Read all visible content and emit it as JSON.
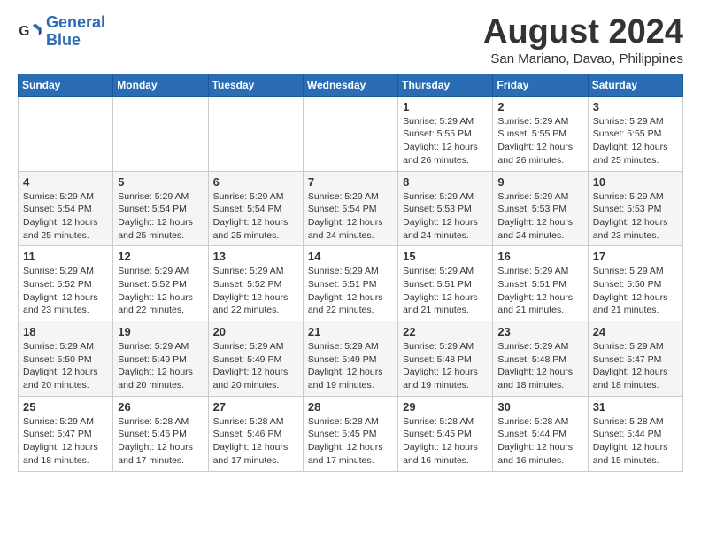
{
  "logo": {
    "line1": "General",
    "line2": "Blue"
  },
  "title": "August 2024",
  "location": "San Mariano, Davao, Philippines",
  "weekdays": [
    "Sunday",
    "Monday",
    "Tuesday",
    "Wednesday",
    "Thursday",
    "Friday",
    "Saturday"
  ],
  "weeks": [
    [
      {
        "day": "",
        "detail": ""
      },
      {
        "day": "",
        "detail": ""
      },
      {
        "day": "",
        "detail": ""
      },
      {
        "day": "",
        "detail": ""
      },
      {
        "day": "1",
        "detail": "Sunrise: 5:29 AM\nSunset: 5:55 PM\nDaylight: 12 hours\nand 26 minutes."
      },
      {
        "day": "2",
        "detail": "Sunrise: 5:29 AM\nSunset: 5:55 PM\nDaylight: 12 hours\nand 26 minutes."
      },
      {
        "day": "3",
        "detail": "Sunrise: 5:29 AM\nSunset: 5:55 PM\nDaylight: 12 hours\nand 25 minutes."
      }
    ],
    [
      {
        "day": "4",
        "detail": "Sunrise: 5:29 AM\nSunset: 5:54 PM\nDaylight: 12 hours\nand 25 minutes."
      },
      {
        "day": "5",
        "detail": "Sunrise: 5:29 AM\nSunset: 5:54 PM\nDaylight: 12 hours\nand 25 minutes."
      },
      {
        "day": "6",
        "detail": "Sunrise: 5:29 AM\nSunset: 5:54 PM\nDaylight: 12 hours\nand 25 minutes."
      },
      {
        "day": "7",
        "detail": "Sunrise: 5:29 AM\nSunset: 5:54 PM\nDaylight: 12 hours\nand 24 minutes."
      },
      {
        "day": "8",
        "detail": "Sunrise: 5:29 AM\nSunset: 5:53 PM\nDaylight: 12 hours\nand 24 minutes."
      },
      {
        "day": "9",
        "detail": "Sunrise: 5:29 AM\nSunset: 5:53 PM\nDaylight: 12 hours\nand 24 minutes."
      },
      {
        "day": "10",
        "detail": "Sunrise: 5:29 AM\nSunset: 5:53 PM\nDaylight: 12 hours\nand 23 minutes."
      }
    ],
    [
      {
        "day": "11",
        "detail": "Sunrise: 5:29 AM\nSunset: 5:52 PM\nDaylight: 12 hours\nand 23 minutes."
      },
      {
        "day": "12",
        "detail": "Sunrise: 5:29 AM\nSunset: 5:52 PM\nDaylight: 12 hours\nand 22 minutes."
      },
      {
        "day": "13",
        "detail": "Sunrise: 5:29 AM\nSunset: 5:52 PM\nDaylight: 12 hours\nand 22 minutes."
      },
      {
        "day": "14",
        "detail": "Sunrise: 5:29 AM\nSunset: 5:51 PM\nDaylight: 12 hours\nand 22 minutes."
      },
      {
        "day": "15",
        "detail": "Sunrise: 5:29 AM\nSunset: 5:51 PM\nDaylight: 12 hours\nand 21 minutes."
      },
      {
        "day": "16",
        "detail": "Sunrise: 5:29 AM\nSunset: 5:51 PM\nDaylight: 12 hours\nand 21 minutes."
      },
      {
        "day": "17",
        "detail": "Sunrise: 5:29 AM\nSunset: 5:50 PM\nDaylight: 12 hours\nand 21 minutes."
      }
    ],
    [
      {
        "day": "18",
        "detail": "Sunrise: 5:29 AM\nSunset: 5:50 PM\nDaylight: 12 hours\nand 20 minutes."
      },
      {
        "day": "19",
        "detail": "Sunrise: 5:29 AM\nSunset: 5:49 PM\nDaylight: 12 hours\nand 20 minutes."
      },
      {
        "day": "20",
        "detail": "Sunrise: 5:29 AM\nSunset: 5:49 PM\nDaylight: 12 hours\nand 20 minutes."
      },
      {
        "day": "21",
        "detail": "Sunrise: 5:29 AM\nSunset: 5:49 PM\nDaylight: 12 hours\nand 19 minutes."
      },
      {
        "day": "22",
        "detail": "Sunrise: 5:29 AM\nSunset: 5:48 PM\nDaylight: 12 hours\nand 19 minutes."
      },
      {
        "day": "23",
        "detail": "Sunrise: 5:29 AM\nSunset: 5:48 PM\nDaylight: 12 hours\nand 18 minutes."
      },
      {
        "day": "24",
        "detail": "Sunrise: 5:29 AM\nSunset: 5:47 PM\nDaylight: 12 hours\nand 18 minutes."
      }
    ],
    [
      {
        "day": "25",
        "detail": "Sunrise: 5:29 AM\nSunset: 5:47 PM\nDaylight: 12 hours\nand 18 minutes."
      },
      {
        "day": "26",
        "detail": "Sunrise: 5:28 AM\nSunset: 5:46 PM\nDaylight: 12 hours\nand 17 minutes."
      },
      {
        "day": "27",
        "detail": "Sunrise: 5:28 AM\nSunset: 5:46 PM\nDaylight: 12 hours\nand 17 minutes."
      },
      {
        "day": "28",
        "detail": "Sunrise: 5:28 AM\nSunset: 5:45 PM\nDaylight: 12 hours\nand 17 minutes."
      },
      {
        "day": "29",
        "detail": "Sunrise: 5:28 AM\nSunset: 5:45 PM\nDaylight: 12 hours\nand 16 minutes."
      },
      {
        "day": "30",
        "detail": "Sunrise: 5:28 AM\nSunset: 5:44 PM\nDaylight: 12 hours\nand 16 minutes."
      },
      {
        "day": "31",
        "detail": "Sunrise: 5:28 AM\nSunset: 5:44 PM\nDaylight: 12 hours\nand 15 minutes."
      }
    ]
  ]
}
